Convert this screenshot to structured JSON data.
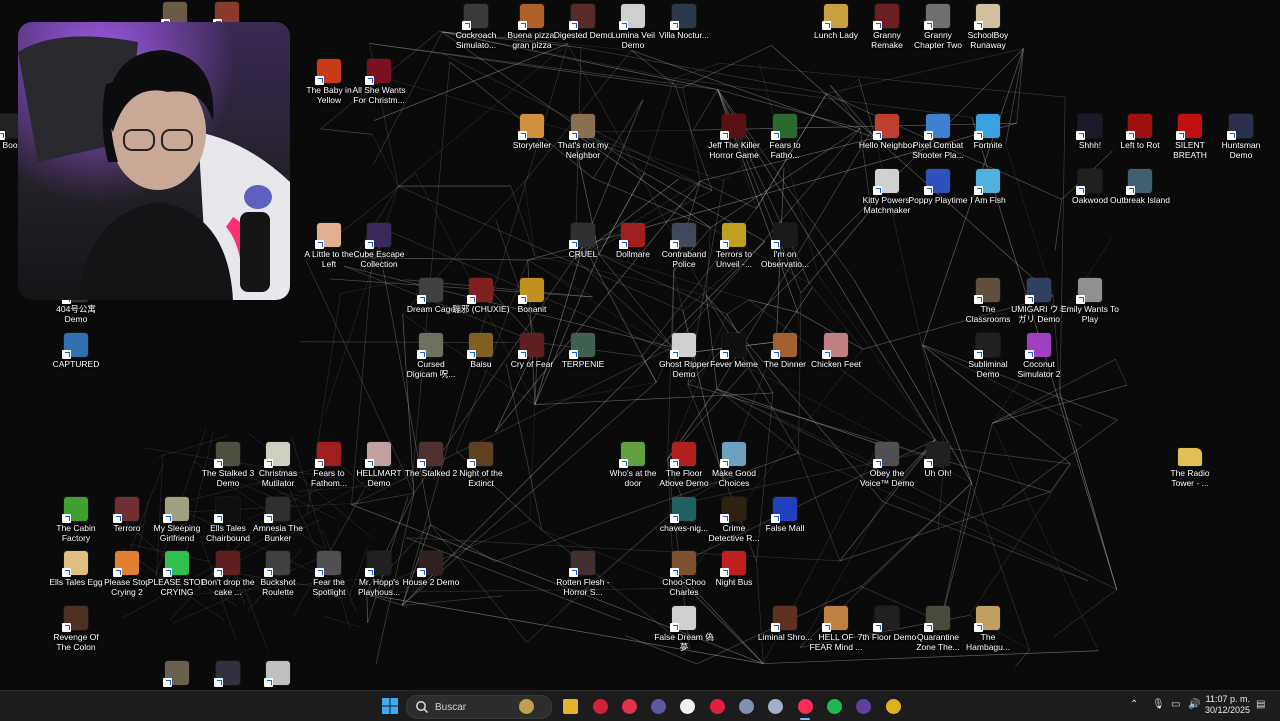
{
  "desktop": {
    "icons": [
      {
        "label": "",
        "color": "#6b5a48",
        "icon": "game-icon"
      },
      {
        "label": "",
        "color": "#8a3a2a",
        "icon": "game-icon"
      },
      {
        "label": "Cockroach Simulato...",
        "color": "#3a3a3a",
        "icon": "game-icon"
      },
      {
        "label": "Buena pizza, gran pizza",
        "color": "#b0602a",
        "icon": "game-icon"
      },
      {
        "label": "Digested Demo",
        "color": "#5a2a2a",
        "icon": "game-icon"
      },
      {
        "label": "Lumina Veil Demo",
        "color": "#cfcfcf",
        "icon": "game-icon"
      },
      {
        "label": "Villa Noctur...",
        "color": "#2a3a4a",
        "icon": "game-icon"
      },
      {
        "label": "Lunch Lady",
        "color": "#c8a040",
        "icon": "game-icon"
      },
      {
        "label": "Granny Remake",
        "color": "#6a2020",
        "icon": "game-icon"
      },
      {
        "label": "Granny Chapter Two",
        "color": "#707070",
        "icon": "game-icon"
      },
      {
        "label": "SchoolBoy Runaway",
        "color": "#d0c0a0",
        "icon": "game-icon"
      },
      {
        "label": "The Baby in Yellow",
        "color": "#c83a1a",
        "icon": "game-icon"
      },
      {
        "label": "All She Wants For Christm...",
        "color": "#7a1020",
        "icon": "game-icon"
      },
      {
        "label": "Boo",
        "color": "#222222",
        "icon": "game-icon"
      },
      {
        "label": "Storyteller",
        "color": "#d09040",
        "icon": "game-icon"
      },
      {
        "label": "That's not my Neighbor",
        "color": "#8a7050",
        "icon": "game-icon"
      },
      {
        "label": "Jeff The Killer Horror Game",
        "color": "#5a1010",
        "icon": "game-icon"
      },
      {
        "label": "Fears to Fatho...",
        "color": "#2a6a2a",
        "icon": "game-icon"
      },
      {
        "label": "Hello Neighbor",
        "color": "#c04030",
        "icon": "game-icon"
      },
      {
        "label": "Pixel Combat Shooter Pla...",
        "color": "#4080d0",
        "icon": "game-icon"
      },
      {
        "label": "Fortnite",
        "color": "#3aa0e0",
        "icon": "game-icon"
      },
      {
        "label": "Shhh!",
        "color": "#1a1a2a",
        "icon": "game-icon"
      },
      {
        "label": "Left to Rot",
        "color": "#a01010",
        "icon": "game-icon"
      },
      {
        "label": "SILENT BREATH",
        "color": "#c01010",
        "icon": "game-icon"
      },
      {
        "label": "Huntsman Demo",
        "color": "#2a3050",
        "icon": "game-icon"
      },
      {
        "label": "Kitty Powers' Matchmaker",
        "color": "#d0d0d0",
        "icon": "game-icon"
      },
      {
        "label": "Poppy Playtime",
        "color": "#3050c0",
        "icon": "game-icon"
      },
      {
        "label": "I Am Fish",
        "color": "#50b0e0",
        "icon": "game-icon"
      },
      {
        "label": "Oakwood",
        "color": "#202020",
        "icon": "game-icon"
      },
      {
        "label": "Outbreak Island",
        "color": "#406070",
        "icon": "game-icon"
      },
      {
        "label": "A Little to the Left",
        "color": "#e0b090",
        "icon": "game-icon"
      },
      {
        "label": "Cube Escape Collection",
        "color": "#3a2a5a",
        "icon": "game-icon"
      },
      {
        "label": "CRUEL",
        "color": "#303030",
        "icon": "game-icon"
      },
      {
        "label": "Dollmare",
        "color": "#a02020",
        "icon": "game-icon"
      },
      {
        "label": "Contraband Police",
        "color": "#404a5a",
        "icon": "game-icon"
      },
      {
        "label": "Terrors to Unveil -...",
        "color": "#c0a020",
        "icon": "game-icon"
      },
      {
        "label": "I'm on Observatio...",
        "color": "#1a1a1a",
        "icon": "game-icon"
      },
      {
        "label": "404号公寓 Demo",
        "color": "#3a3030",
        "icon": "game-icon"
      },
      {
        "label": "Dream Cage",
        "color": "#404040",
        "icon": "game-icon"
      },
      {
        "label": "蹦邪 (CHUXIE)",
        "color": "#802020",
        "icon": "game-icon"
      },
      {
        "label": "Bonanit",
        "color": "#c09020",
        "icon": "game-icon"
      },
      {
        "label": "The Classrooms",
        "color": "#605040",
        "icon": "game-icon"
      },
      {
        "label": "UMIGARI ウミガリ Demo",
        "color": "#304060",
        "icon": "game-icon"
      },
      {
        "label": "Emily Wants To Play",
        "color": "#909090",
        "icon": "game-icon"
      },
      {
        "label": "CAPTURED",
        "color": "#3070b0",
        "icon": "game-icon"
      },
      {
        "label": "Cursed Digicam 呪...",
        "color": "#707060",
        "icon": "game-icon"
      },
      {
        "label": "Baisu",
        "color": "#806020",
        "icon": "game-icon"
      },
      {
        "label": "Cry of Fear",
        "color": "#602020",
        "icon": "game-icon"
      },
      {
        "label": "TERPENIE",
        "color": "#406050",
        "icon": "game-icon"
      },
      {
        "label": "Ghost Ripper Demo",
        "color": "#d0d0d0",
        "icon": "game-icon"
      },
      {
        "label": "Fever Meme",
        "color": "#101010",
        "icon": "game-icon"
      },
      {
        "label": "The Dinner",
        "color": "#a06030",
        "icon": "game-icon"
      },
      {
        "label": "Chicken Feet",
        "color": "#c08080",
        "icon": "game-icon"
      },
      {
        "label": "Subliminal Demo",
        "color": "#202020",
        "icon": "game-icon"
      },
      {
        "label": "Coconut Simulator 2",
        "color": "#a040c0",
        "icon": "game-icon"
      },
      {
        "label": "The Stalked 3 Demo",
        "color": "#505040",
        "icon": "game-icon"
      },
      {
        "label": "Christmas Mutilator",
        "color": "#d0d0c0",
        "icon": "game-icon"
      },
      {
        "label": "Fears to Fathom...",
        "color": "#a02020",
        "icon": "game-icon"
      },
      {
        "label": "HELLMART Demo",
        "color": "#c0a0a0",
        "icon": "game-icon"
      },
      {
        "label": "The Stalked 2",
        "color": "#503030",
        "icon": "game-icon"
      },
      {
        "label": "Night of the Extinct",
        "color": "#604020",
        "icon": "game-icon"
      },
      {
        "label": "Who's at the door",
        "color": "#60a040",
        "icon": "game-icon"
      },
      {
        "label": "The Floor Above Demo",
        "color": "#b02020",
        "icon": "game-icon"
      },
      {
        "label": "Make Good Choices",
        "color": "#70a0c0",
        "icon": "game-icon"
      },
      {
        "label": "Obey the Voice™ Demo",
        "color": "#505050",
        "icon": "game-icon"
      },
      {
        "label": "Uh Oh!",
        "color": "#202020",
        "icon": "game-icon"
      },
      {
        "label": "The Radio Tower - ...",
        "color": "#e0c050",
        "icon": "folder-icon"
      },
      {
        "label": "The Cabin Factory",
        "color": "#40a030",
        "icon": "game-icon"
      },
      {
        "label": "Terroro",
        "color": "#703030",
        "icon": "game-icon"
      },
      {
        "label": "My Sleeping Girlfriend",
        "color": "#a0a080",
        "icon": "game-icon"
      },
      {
        "label": "Ells Tales Chairbound",
        "color": "#101010",
        "icon": "game-icon"
      },
      {
        "label": "Amnesia The Bunker",
        "color": "#303030",
        "icon": "game-icon"
      },
      {
        "label": "chaves-nig...",
        "color": "#206060",
        "icon": "game-icon"
      },
      {
        "label": "Crime Detective R...",
        "color": "#302010",
        "icon": "game-icon"
      },
      {
        "label": "False Mall",
        "color": "#2040c0",
        "icon": "game-icon"
      },
      {
        "label": "Ells Tales Egg",
        "color": "#e0c080",
        "icon": "game-icon"
      },
      {
        "label": "Please Stop Crying 2",
        "color": "#e08030",
        "icon": "game-icon"
      },
      {
        "label": "PLEASE STOP CRYING",
        "color": "#30c050",
        "icon": "game-icon"
      },
      {
        "label": "Don't drop the cake ...",
        "color": "#602020",
        "icon": "game-icon"
      },
      {
        "label": "Buckshot Roulette",
        "color": "#404040",
        "icon": "game-icon"
      },
      {
        "label": "Fear the Spotlight",
        "color": "#505050",
        "icon": "game-icon"
      },
      {
        "label": "Mr. Hopp's Playhous...",
        "color": "#202020",
        "icon": "game-icon"
      },
      {
        "label": "House 2 Demo",
        "color": "#302020",
        "icon": "game-icon"
      },
      {
        "label": "Rotten Flesh - Horror S...",
        "color": "#403030",
        "icon": "game-icon"
      },
      {
        "label": "Choo-Choo Charles",
        "color": "#805030",
        "icon": "game-icon"
      },
      {
        "label": "Night Bus",
        "color": "#c02020",
        "icon": "game-icon"
      },
      {
        "label": "Revenge Of The Colon",
        "color": "#503020",
        "icon": "game-icon"
      },
      {
        "label": "False Dream 偽夢",
        "color": "#d0d0d0",
        "icon": "game-icon"
      },
      {
        "label": "Liminal Shro...",
        "color": "#603020",
        "icon": "game-icon"
      },
      {
        "label": "HELL OF FEAR Mind ...",
        "color": "#c08040",
        "icon": "game-icon"
      },
      {
        "label": "7th Floor Demo",
        "color": "#202020",
        "icon": "game-icon"
      },
      {
        "label": "Quarantine Zone The...",
        "color": "#4a4a3a",
        "icon": "game-icon"
      },
      {
        "label": "The Hambagu...",
        "color": "#c0a060",
        "icon": "game-icon"
      },
      {
        "label": "",
        "color": "#6a6050",
        "icon": "game-icon"
      },
      {
        "label": "",
        "color": "#303040",
        "icon": "game-icon"
      },
      {
        "label": "",
        "color": "#c0c0c0",
        "icon": "game-icon"
      }
    ]
  },
  "taskbar": {
    "search_placeholder": "Buscar",
    "apps": [
      {
        "name": "search-widget-icon",
        "color": "#c0a050"
      },
      {
        "name": "file-explorer-icon",
        "color": "#e8b430"
      },
      {
        "name": "opera-gx-icon",
        "color": "#d0203a"
      },
      {
        "name": "record-app-icon",
        "color": "#e0304a"
      },
      {
        "name": "obs-icon",
        "color": "#5a5aa0"
      },
      {
        "name": "capcut-icon",
        "color": "#f0f0f0"
      },
      {
        "name": "tf-app-icon",
        "color": "#e02040"
      },
      {
        "name": "discord-icon",
        "color": "#8090b0"
      },
      {
        "name": "steam-icon",
        "color": "#a0b0c8"
      },
      {
        "name": "tiktok-icon",
        "color": "#ff2d55"
      },
      {
        "name": "spotify-icon",
        "color": "#1db954"
      },
      {
        "name": "next-app-icon",
        "color": "#6040a0"
      },
      {
        "name": "norton-icon",
        "color": "#e0b020"
      }
    ],
    "time": "11:07 p. m.",
    "date": "30/12/2025"
  }
}
